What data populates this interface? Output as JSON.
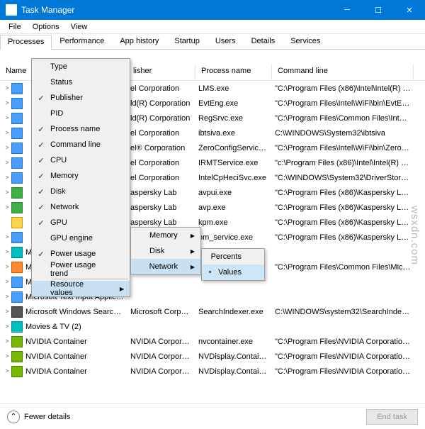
{
  "title": "Task Manager",
  "menubar": [
    "File",
    "Options",
    "View"
  ],
  "tabs": [
    "Processes",
    "Performance",
    "App history",
    "Startup",
    "Users",
    "Details",
    "Services"
  ],
  "active_tab": 0,
  "columns": [
    "Name",
    "lisher",
    "Process name",
    "Command line"
  ],
  "rows": [
    {
      "exp": ">",
      "ico": "blue",
      "pub": "el Corporation",
      "proc": "LMS.exe",
      "cmd": "\"C:\\Program Files (x86)\\Intel\\Intel(R) Manag..."
    },
    {
      "exp": ">",
      "ico": "blue",
      "pub": "ld(R) Corporation",
      "proc": "EvtEng.exe",
      "cmd": "\"C:\\Program Files\\Intel\\WiFi\\bin\\EvtEng.exe\""
    },
    {
      "exp": ">",
      "ico": "blue",
      "pub": "ld(R) Corporation",
      "proc": "RegSrvc.exe",
      "cmd": "\"C:\\Program Files\\Common Files\\Intel\\Wirel..."
    },
    {
      "exp": ">",
      "ico": "blue",
      "pub": "el Corporation",
      "proc": "ibtsiva.exe",
      "cmd": "C:\\WINDOWS\\System32\\ibtsiva"
    },
    {
      "exp": ">",
      "ico": "blue",
      "pub": "el® Corporation",
      "proc": "ZeroConfigService.exe",
      "cmd": "\"C:\\Program Files\\Intel\\WiFi\\bin\\ZeroConfig..."
    },
    {
      "exp": ">",
      "ico": "blue",
      "pub": "el Corporation",
      "proc": "IRMTService.exe",
      "cmd": "\"c:\\Program Files (x86)\\Intel\\Intel(R) Ready Mode ..."
    },
    {
      "exp": ">",
      "ico": "blue",
      "pub": "el Corporation",
      "proc": "IntelCpHeciSvc.exe",
      "cmd": "\"C:\\WINDOWS\\System32\\DriverStore\\FileRep..."
    },
    {
      "exp": ">",
      "ico": "green",
      "pub": "aspersky Lab",
      "proc": "avpui.exe",
      "cmd": "\"C:\\Program Files (x86)\\Kaspersky Lab\\Kasper..."
    },
    {
      "exp": ">",
      "ico": "green",
      "pub": "aspersky Lab",
      "proc": "avp.exe",
      "cmd": "\"C:\\Program Files (x86)\\Kaspersky Lab\\Kasper..."
    },
    {
      "exp": "",
      "ico": "yellow",
      "pub": "aspersky Lab",
      "proc": "kpm.exe",
      "cmd": "\"C:\\Program Files (x86)\\Kaspersky Lab\\Kasper..."
    },
    {
      "exp": ">",
      "ico": "blue",
      "pub": "",
      "proc": "om_service.exe",
      "cmd": "\"C:\\Program Files (x86)\\Kaspersky Lab\\Kasper..."
    },
    {
      "exp": ">",
      "ico": "teal",
      "name": "Microsoft Edge (5)",
      "pub": "",
      "proc": "",
      "cmd": ""
    },
    {
      "exp": ">",
      "ico": "orange",
      "name": "Microsoft Office Click-to-Ru...",
      "pub": "Microsoft Corporation",
      "proc": "",
      "cmd": "\"C:\\Program Files\\Common Files\\Microsoft ..."
    },
    {
      "exp": ">",
      "ico": "blue",
      "name": "Microsoft Store (2)",
      "pub": "",
      "proc": "",
      "cmd": ""
    },
    {
      "exp": ">",
      "ico": "blue",
      "name": "Microsoft Text Input Applicat...",
      "pub": "",
      "proc": "",
      "cmd": ""
    },
    {
      "exp": ">",
      "ico": "dk",
      "name": "Microsoft Windows Search I...",
      "pub": "Microsoft Corporation",
      "proc": "SearchIndexer.exe",
      "cmd": "C:\\WINDOWS\\system32\\SearchIndexer.exe /Em..."
    },
    {
      "exp": ">",
      "ico": "teal",
      "name": "Movies & TV (2)",
      "pub": "",
      "proc": "",
      "cmd": ""
    },
    {
      "exp": ">",
      "ico": "nv",
      "name": "NVIDIA Container",
      "pub": "NVIDIA Corporation",
      "proc": "nvcontainer.exe",
      "cmd": "\"C:\\Program Files\\NVIDIA Corporation\\NvCo..."
    },
    {
      "exp": ">",
      "ico": "nv",
      "name": "NVIDIA Container",
      "pub": "NVIDIA Corporation",
      "proc": "NVDisplay.Container.e...",
      "cmd": "\"C:\\Program Files\\NVIDIA Corporation\\Displ..."
    },
    {
      "exp": ">",
      "ico": "nv",
      "name": "NVIDIA Container",
      "pub": "NVIDIA Corporation",
      "proc": "NVDisplay.Container.e...",
      "cmd": "\"C:\\Program Files\\NVIDIA Corporation\\Displ..."
    }
  ],
  "ctx1": {
    "items": [
      "Type",
      "Status",
      "Publisher",
      "PID",
      "Process name",
      "Command line",
      "CPU",
      "Memory",
      "Disk",
      "Network",
      "GPU",
      "GPU engine",
      "Power usage",
      "Power usage trend"
    ],
    "checked": [
      2,
      4,
      5,
      6,
      7,
      8,
      9,
      10,
      12
    ],
    "highlight": "Resource values"
  },
  "ctx2": {
    "items": [
      "Memory",
      "Disk",
      "Network"
    ],
    "highlight": 2
  },
  "ctx3": {
    "items": [
      "Percents",
      "Values"
    ],
    "selected": 1
  },
  "footer": {
    "fewer": "Fewer details",
    "end": "End task"
  },
  "watermark": "wsxdn.com"
}
